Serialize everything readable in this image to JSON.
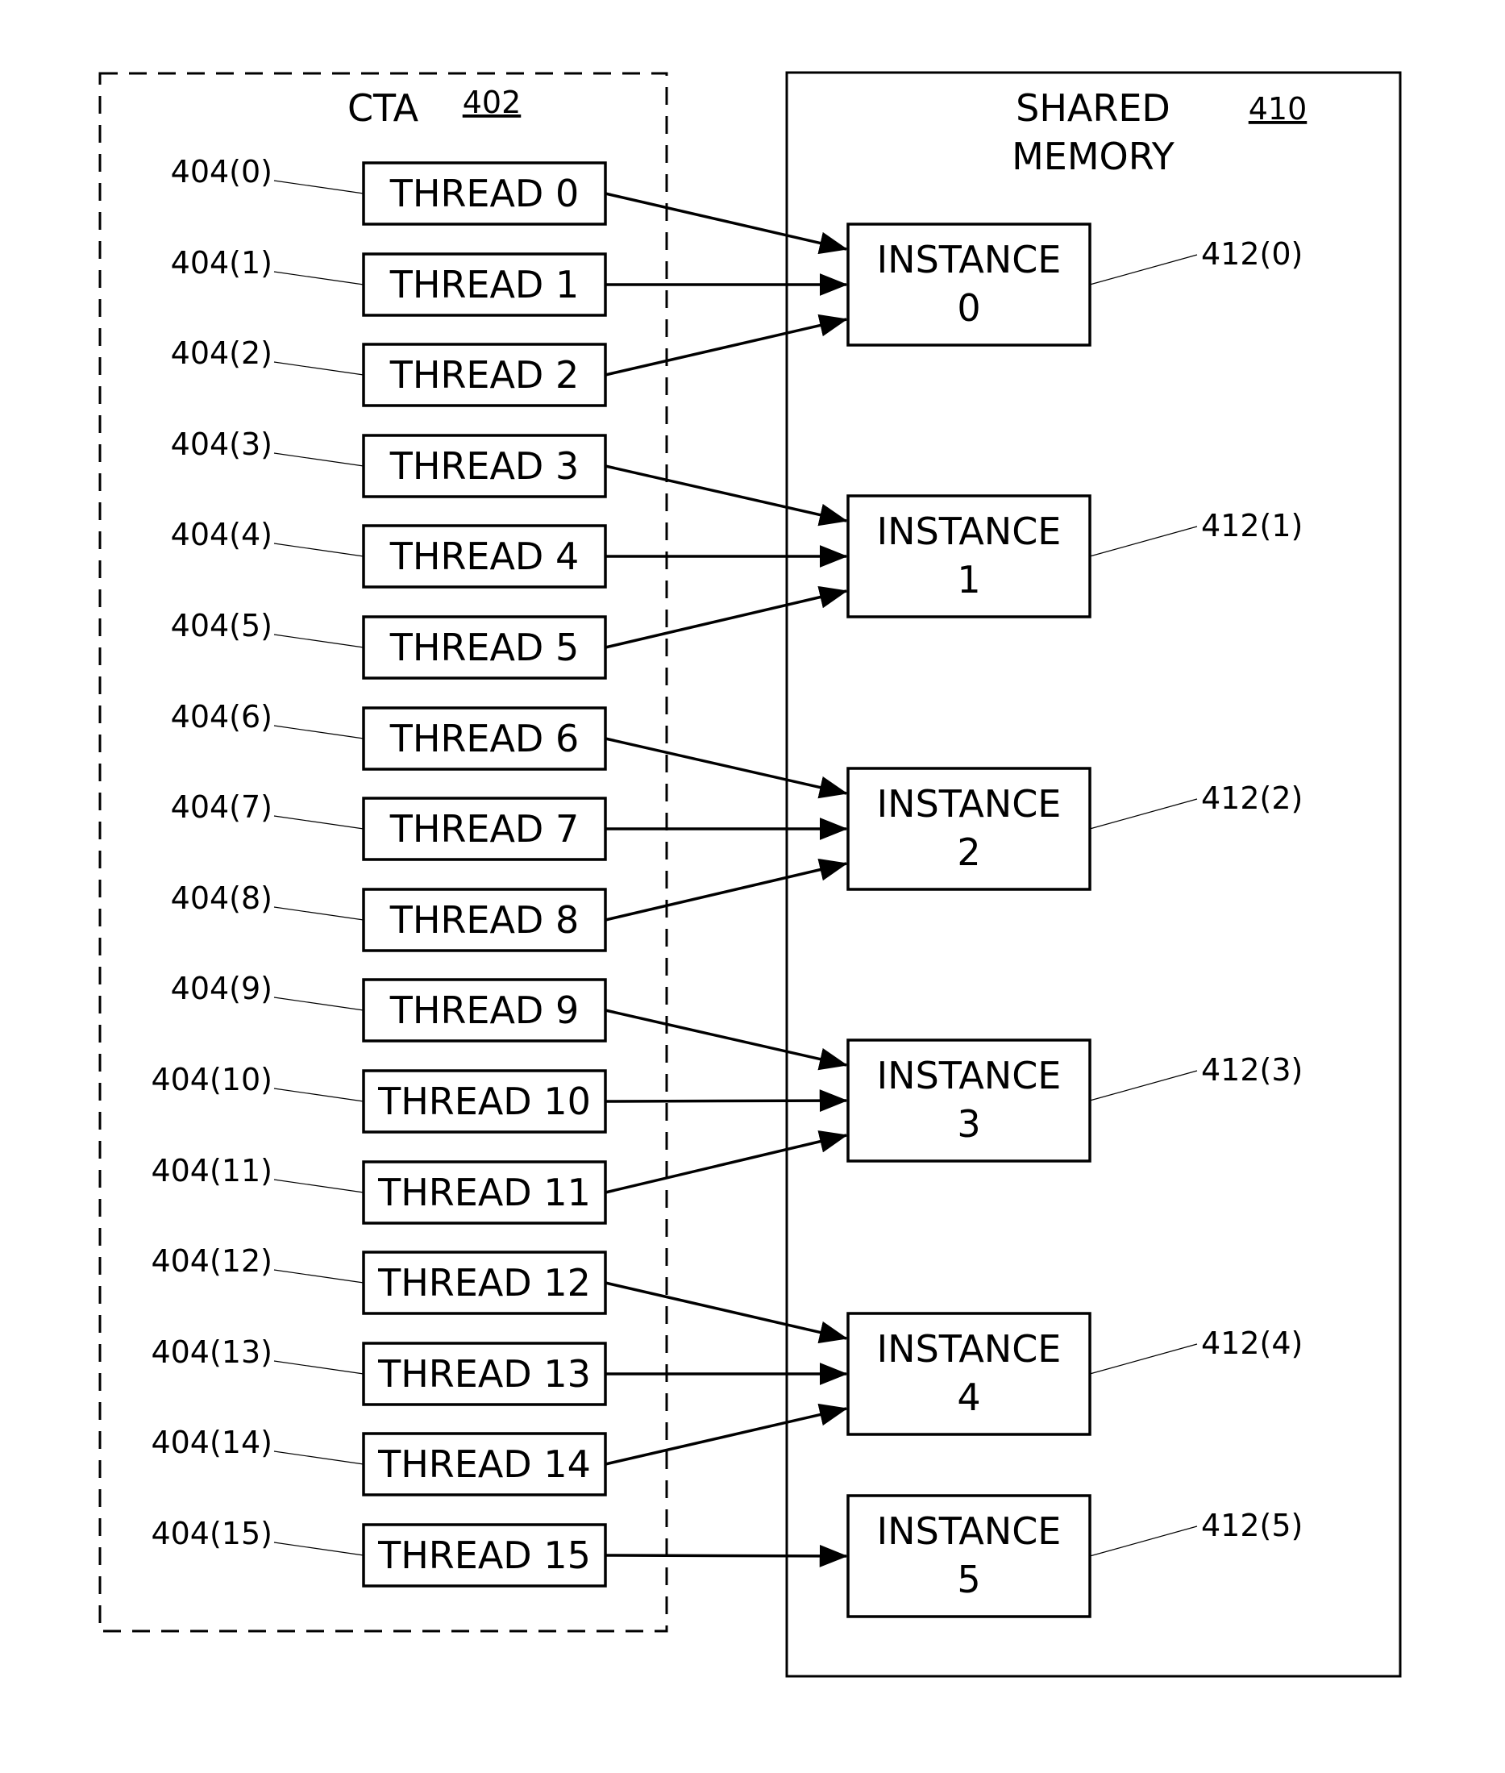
{
  "colors": {
    "stroke": "#000000",
    "background": "#ffffff"
  },
  "cta": {
    "title": "CTA",
    "ref": "402",
    "threads": [
      {
        "label": "THREAD 0",
        "ref": "404(0)",
        "target": 0
      },
      {
        "label": "THREAD 1",
        "ref": "404(1)",
        "target": 0
      },
      {
        "label": "THREAD 2",
        "ref": "404(2)",
        "target": 0
      },
      {
        "label": "THREAD 3",
        "ref": "404(3)",
        "target": 1
      },
      {
        "label": "THREAD 4",
        "ref": "404(4)",
        "target": 1
      },
      {
        "label": "THREAD 5",
        "ref": "404(5)",
        "target": 1
      },
      {
        "label": "THREAD 6",
        "ref": "404(6)",
        "target": 2
      },
      {
        "label": "THREAD 7",
        "ref": "404(7)",
        "target": 2
      },
      {
        "label": "THREAD 8",
        "ref": "404(8)",
        "target": 2
      },
      {
        "label": "THREAD 9",
        "ref": "404(9)",
        "target": 3
      },
      {
        "label": "THREAD 10",
        "ref": "404(10)",
        "target": 3
      },
      {
        "label": "THREAD 11",
        "ref": "404(11)",
        "target": 3
      },
      {
        "label": "THREAD 12",
        "ref": "404(12)",
        "target": 4
      },
      {
        "label": "THREAD 13",
        "ref": "404(13)",
        "target": 4
      },
      {
        "label": "THREAD 14",
        "ref": "404(14)",
        "target": 4
      },
      {
        "label": "THREAD 15",
        "ref": "404(15)",
        "target": 5
      }
    ]
  },
  "shared_memory": {
    "title_line1": "SHARED",
    "title_line2": "MEMORY",
    "ref": "410",
    "instances": [
      {
        "line1": "INSTANCE",
        "line2": "0",
        "ref": "412(0)"
      },
      {
        "line1": "INSTANCE",
        "line2": "1",
        "ref": "412(1)"
      },
      {
        "line1": "INSTANCE",
        "line2": "2",
        "ref": "412(2)"
      },
      {
        "line1": "INSTANCE",
        "line2": "3",
        "ref": "412(3)"
      },
      {
        "line1": "INSTANCE",
        "line2": "4",
        "ref": "412(4)"
      },
      {
        "line1": "INSTANCE",
        "line2": "5",
        "ref": "412(5)"
      }
    ]
  }
}
